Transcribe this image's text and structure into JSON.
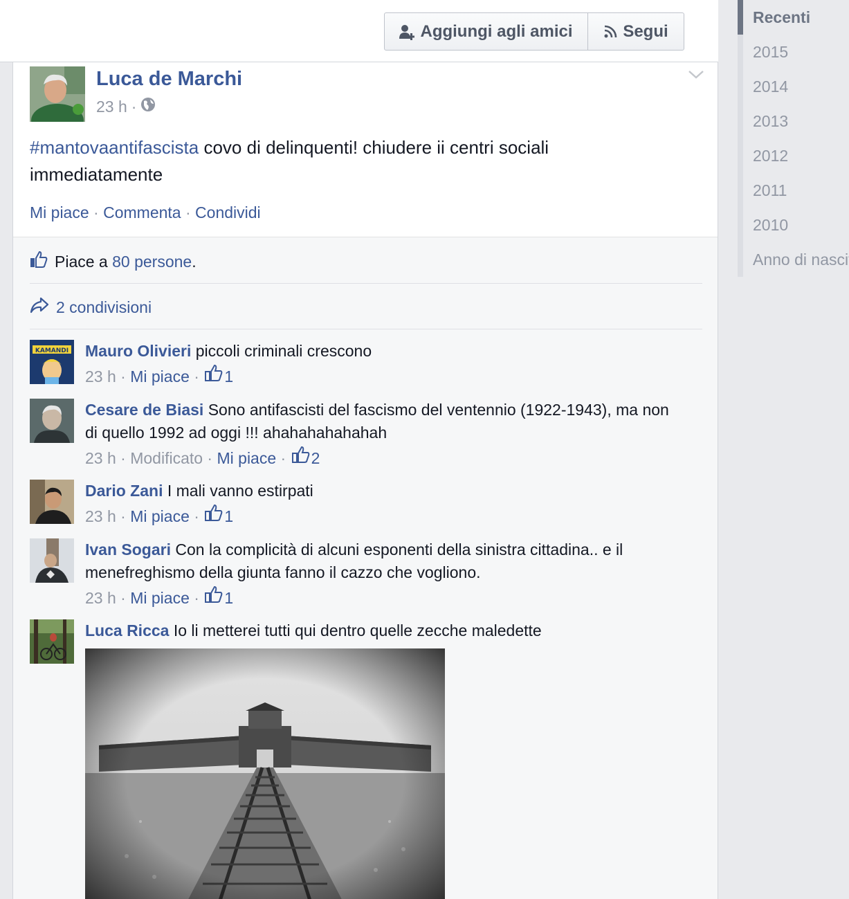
{
  "header": {
    "add_friend_label": "Aggiungi agli amici",
    "follow_label": "Segui"
  },
  "post": {
    "author": "Luca de Marchi",
    "time": "23 h",
    "hashtag": "#mantovaantifascista",
    "text": " covo di delinquenti! chiudere ii centri sociali immediatamente",
    "actions": {
      "like": "Mi piace",
      "comment": "Commenta",
      "share": "Condividi",
      "sep": " · "
    }
  },
  "ufi": {
    "likes_prefix": "Piace a ",
    "likes_link": "80 persone",
    "likes_suffix": ".",
    "shares": "2 condivisioni"
  },
  "comments": [
    {
      "name": "Mauro Olivieri",
      "text": " piccoli criminali crescono",
      "time": "23 h",
      "edited": "",
      "like": "Mi piace",
      "likes": "1",
      "avatar_text": "KAMANDI"
    },
    {
      "name": "Cesare de Biasi",
      "text": " Sono antifascisti del fascismo del ventennio (1922-1943), ma non di quello 1992 ad oggi !!! ahahahahahahah",
      "time": "23 h",
      "edited": "Modificato",
      "like": "Mi piace",
      "likes": "2"
    },
    {
      "name": "Dario Zani",
      "text": " I mali vanno estirpati",
      "time": "23 h",
      "edited": "",
      "like": "Mi piace",
      "likes": "1"
    },
    {
      "name": "Ivan Sogari",
      "text": " Con la complicità di alcuni esponenti della sinistra cittadina.. e il menefreghismo della giunta fanno il cazzo che vogliono.",
      "time": "23 h",
      "edited": "",
      "like": "Mi piace",
      "likes": "1"
    },
    {
      "name": "Luca Ricca",
      "text": " Io li metterei tutti qui dentro quelle zecche maledette"
    }
  ],
  "timeline": {
    "items": [
      "Recenti",
      "2015",
      "2014",
      "2013",
      "2012",
      "2011",
      "2010",
      "Anno di nascita"
    ],
    "active": "Recenti"
  },
  "colors": {
    "link": "#3b5998",
    "meta": "#9197a3",
    "background": "#e9eaed"
  }
}
